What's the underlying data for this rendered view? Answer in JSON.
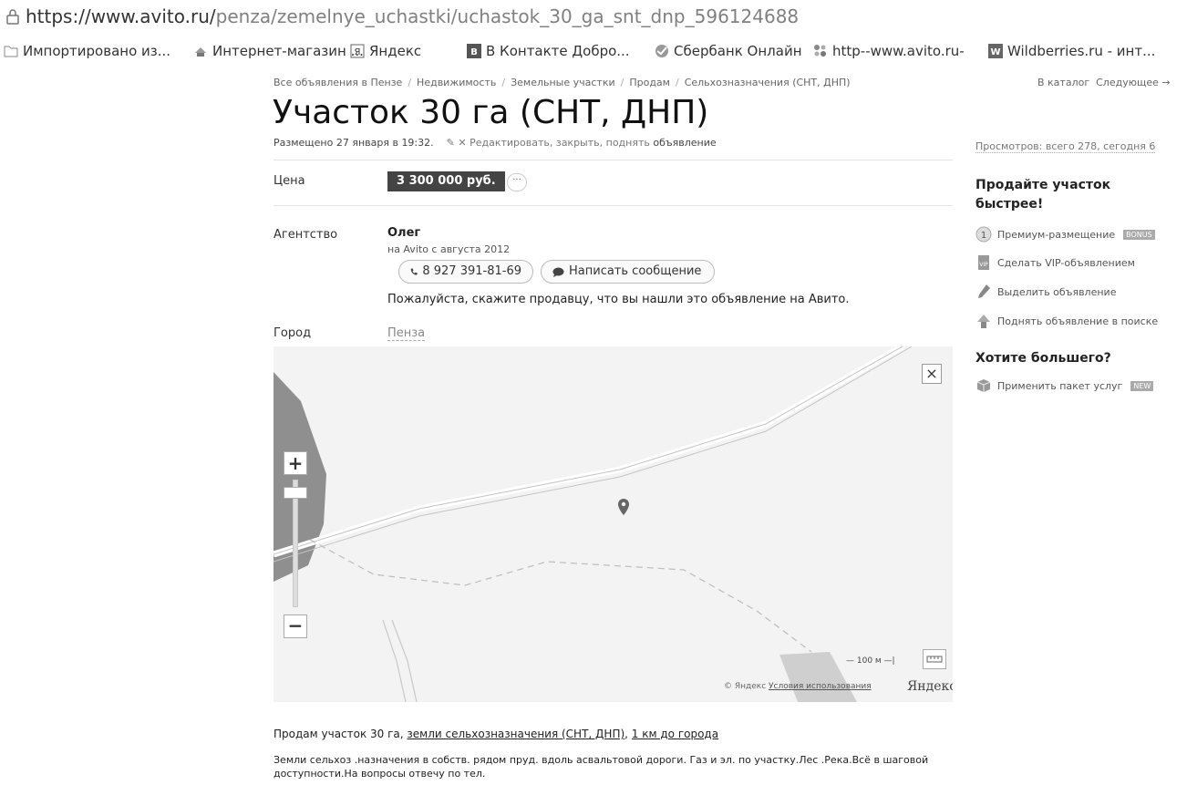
{
  "browser": {
    "url_host": "https://www.avito.ru/",
    "url_path": "penza/zemelnye_uchastki/uchastok_30_ga_snt_dnp_596124688",
    "bookmarks": [
      {
        "label": "Импортировано из...",
        "icon": "folder-icon"
      },
      {
        "label": "Интернет-магазин ...",
        "icon": "shop-icon"
      },
      {
        "label": "Яндекс",
        "icon": "yandex-icon"
      },
      {
        "label": "В Контакте  Добро...",
        "icon": "vk-icon"
      },
      {
        "label": "Сбербанк Онлайн",
        "icon": "sberbank-icon"
      },
      {
        "label": "http--www.avito.ru-",
        "icon": "avito-icon"
      },
      {
        "label": "Wildberries.ru - инт...",
        "icon": "wildberries-icon"
      }
    ]
  },
  "breadcrumbs": [
    "Все объявления в Пензе",
    "Недвижимость",
    "Земельные участки",
    "Продам",
    "Сельхозназначения (СНТ, ДНП)"
  ],
  "nav": {
    "catalog": "В каталог",
    "next": "Следующее →"
  },
  "listing": {
    "title": "Участок 30 га (СНТ, ДНП)",
    "posted": "Размещено 27 января в 19:32.",
    "edit_link": "Редактировать, закрыть, поднять",
    "edit_suffix": "объявление",
    "price_label": "Цена",
    "price": "3 300 000 руб.",
    "price_more": "···",
    "agency_label": "Агентство",
    "seller_name": "Олег",
    "seller_since": "на Avito с августа 2012",
    "phone": "8 927 391-81-69",
    "message_button": "Написать сообщение",
    "notice": "Пожалуйста, скажите продавцу, что вы нашли это объявление на Авито.",
    "city_label": "Город",
    "city": "Пенза"
  },
  "map": {
    "close": "×",
    "zoom_in": "+",
    "zoom_out": "−",
    "scale": "— 100 м —|",
    "copyright": "© Яндекс",
    "terms_link": "Условия использования",
    "logo": "Яндекс"
  },
  "description": {
    "summary_prefix": "Продам участок 30 га, ",
    "summary_link1": "земли сельхозназначения (СНТ, ДНП)",
    "summary_sep": ", ",
    "summary_link2": "1 км до города",
    "body": "Земли сельхоз .назначения в собств. рядом пруд. вдоль асвальтовой дороги. Газ и эл. по участку.Лес .Река.Всё в шаговой доступности.На вопросы отвечу по тел."
  },
  "sidebar": {
    "views": "Просмотров: всего 278, сегодня 6",
    "sell_heading_1": "Продайте участок",
    "sell_heading_2": "быстрее!",
    "services": [
      {
        "label": "Премиум-размещение",
        "badge": "BONUS",
        "icon": "premium-icon"
      },
      {
        "label": "Сделать VIP-объявлением",
        "badge": "",
        "icon": "vip-icon"
      },
      {
        "label": "Выделить объявление",
        "badge": "",
        "icon": "highlight-icon"
      },
      {
        "label": "Поднять объявление в поиске",
        "badge": "",
        "icon": "raise-icon"
      }
    ],
    "more_heading": "Хотите большего?",
    "package": {
      "label": "Применить пакет услуг",
      "badge": "NEW",
      "icon": "package-icon"
    }
  },
  "colors": {
    "price_badge_bg": "#444444",
    "map_bg": "#f3f3f3",
    "link_muted": "#888888"
  }
}
